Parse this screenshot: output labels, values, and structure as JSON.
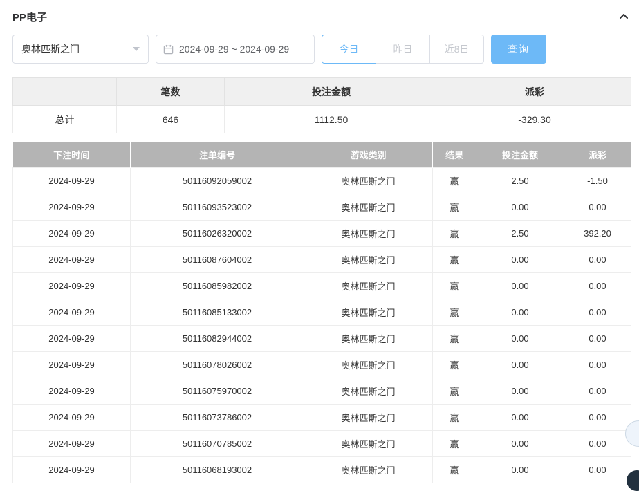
{
  "header": {
    "title": "PP电子"
  },
  "filters": {
    "game_select": {
      "value": "奥林匹斯之门"
    },
    "date_range": {
      "value": "2024-09-29 ~ 2024-09-29"
    },
    "quick_buttons": [
      {
        "label": "今日"
      },
      {
        "label": "昨日"
      },
      {
        "label": "近8日"
      }
    ],
    "search_label": "查询"
  },
  "summary": {
    "headers": [
      "",
      "笔数",
      "投注金额",
      "派彩"
    ],
    "row_label": "总计",
    "count": "646",
    "bet_amount": "1112.50",
    "payout": "-329.30"
  },
  "table": {
    "headers": [
      "下注时间",
      "注单编号",
      "游戏类别",
      "结果",
      "投注金额",
      "派彩"
    ],
    "rows": [
      {
        "date": "2024-09-29",
        "order_no": "50116092059002",
        "game": "奥林匹斯之门",
        "result": "赢",
        "bet": "2.50",
        "payout": "-1.50"
      },
      {
        "date": "2024-09-29",
        "order_no": "50116093523002",
        "game": "奥林匹斯之门",
        "result": "赢",
        "bet": "0.00",
        "payout": "0.00"
      },
      {
        "date": "2024-09-29",
        "order_no": "50116026320002",
        "game": "奥林匹斯之门",
        "result": "赢",
        "bet": "2.50",
        "payout": "392.20"
      },
      {
        "date": "2024-09-29",
        "order_no": "50116087604002",
        "game": "奥林匹斯之门",
        "result": "赢",
        "bet": "0.00",
        "payout": "0.00"
      },
      {
        "date": "2024-09-29",
        "order_no": "50116085982002",
        "game": "奥林匹斯之门",
        "result": "赢",
        "bet": "0.00",
        "payout": "0.00"
      },
      {
        "date": "2024-09-29",
        "order_no": "50116085133002",
        "game": "奥林匹斯之门",
        "result": "赢",
        "bet": "0.00",
        "payout": "0.00"
      },
      {
        "date": "2024-09-29",
        "order_no": "50116082944002",
        "game": "奥林匹斯之门",
        "result": "赢",
        "bet": "0.00",
        "payout": "0.00"
      },
      {
        "date": "2024-09-29",
        "order_no": "50116078026002",
        "game": "奥林匹斯之门",
        "result": "赢",
        "bet": "0.00",
        "payout": "0.00"
      },
      {
        "date": "2024-09-29",
        "order_no": "50116075970002",
        "game": "奥林匹斯之门",
        "result": "赢",
        "bet": "0.00",
        "payout": "0.00"
      },
      {
        "date": "2024-09-29",
        "order_no": "50116073786002",
        "game": "奥林匹斯之门",
        "result": "赢",
        "bet": "0.00",
        "payout": "0.00"
      },
      {
        "date": "2024-09-29",
        "order_no": "50116070785002",
        "game": "奥林匹斯之门",
        "result": "赢",
        "bet": "0.00",
        "payout": "0.00"
      },
      {
        "date": "2024-09-29",
        "order_no": "50116068193002",
        "game": "奥林匹斯之门",
        "result": "赢",
        "bet": "0.00",
        "payout": "0.00"
      }
    ]
  },
  "colors": {
    "accent_blue": "#6db9f7",
    "negative_red": "#f25d5d",
    "table_header_gray": "#b4b4b4"
  }
}
